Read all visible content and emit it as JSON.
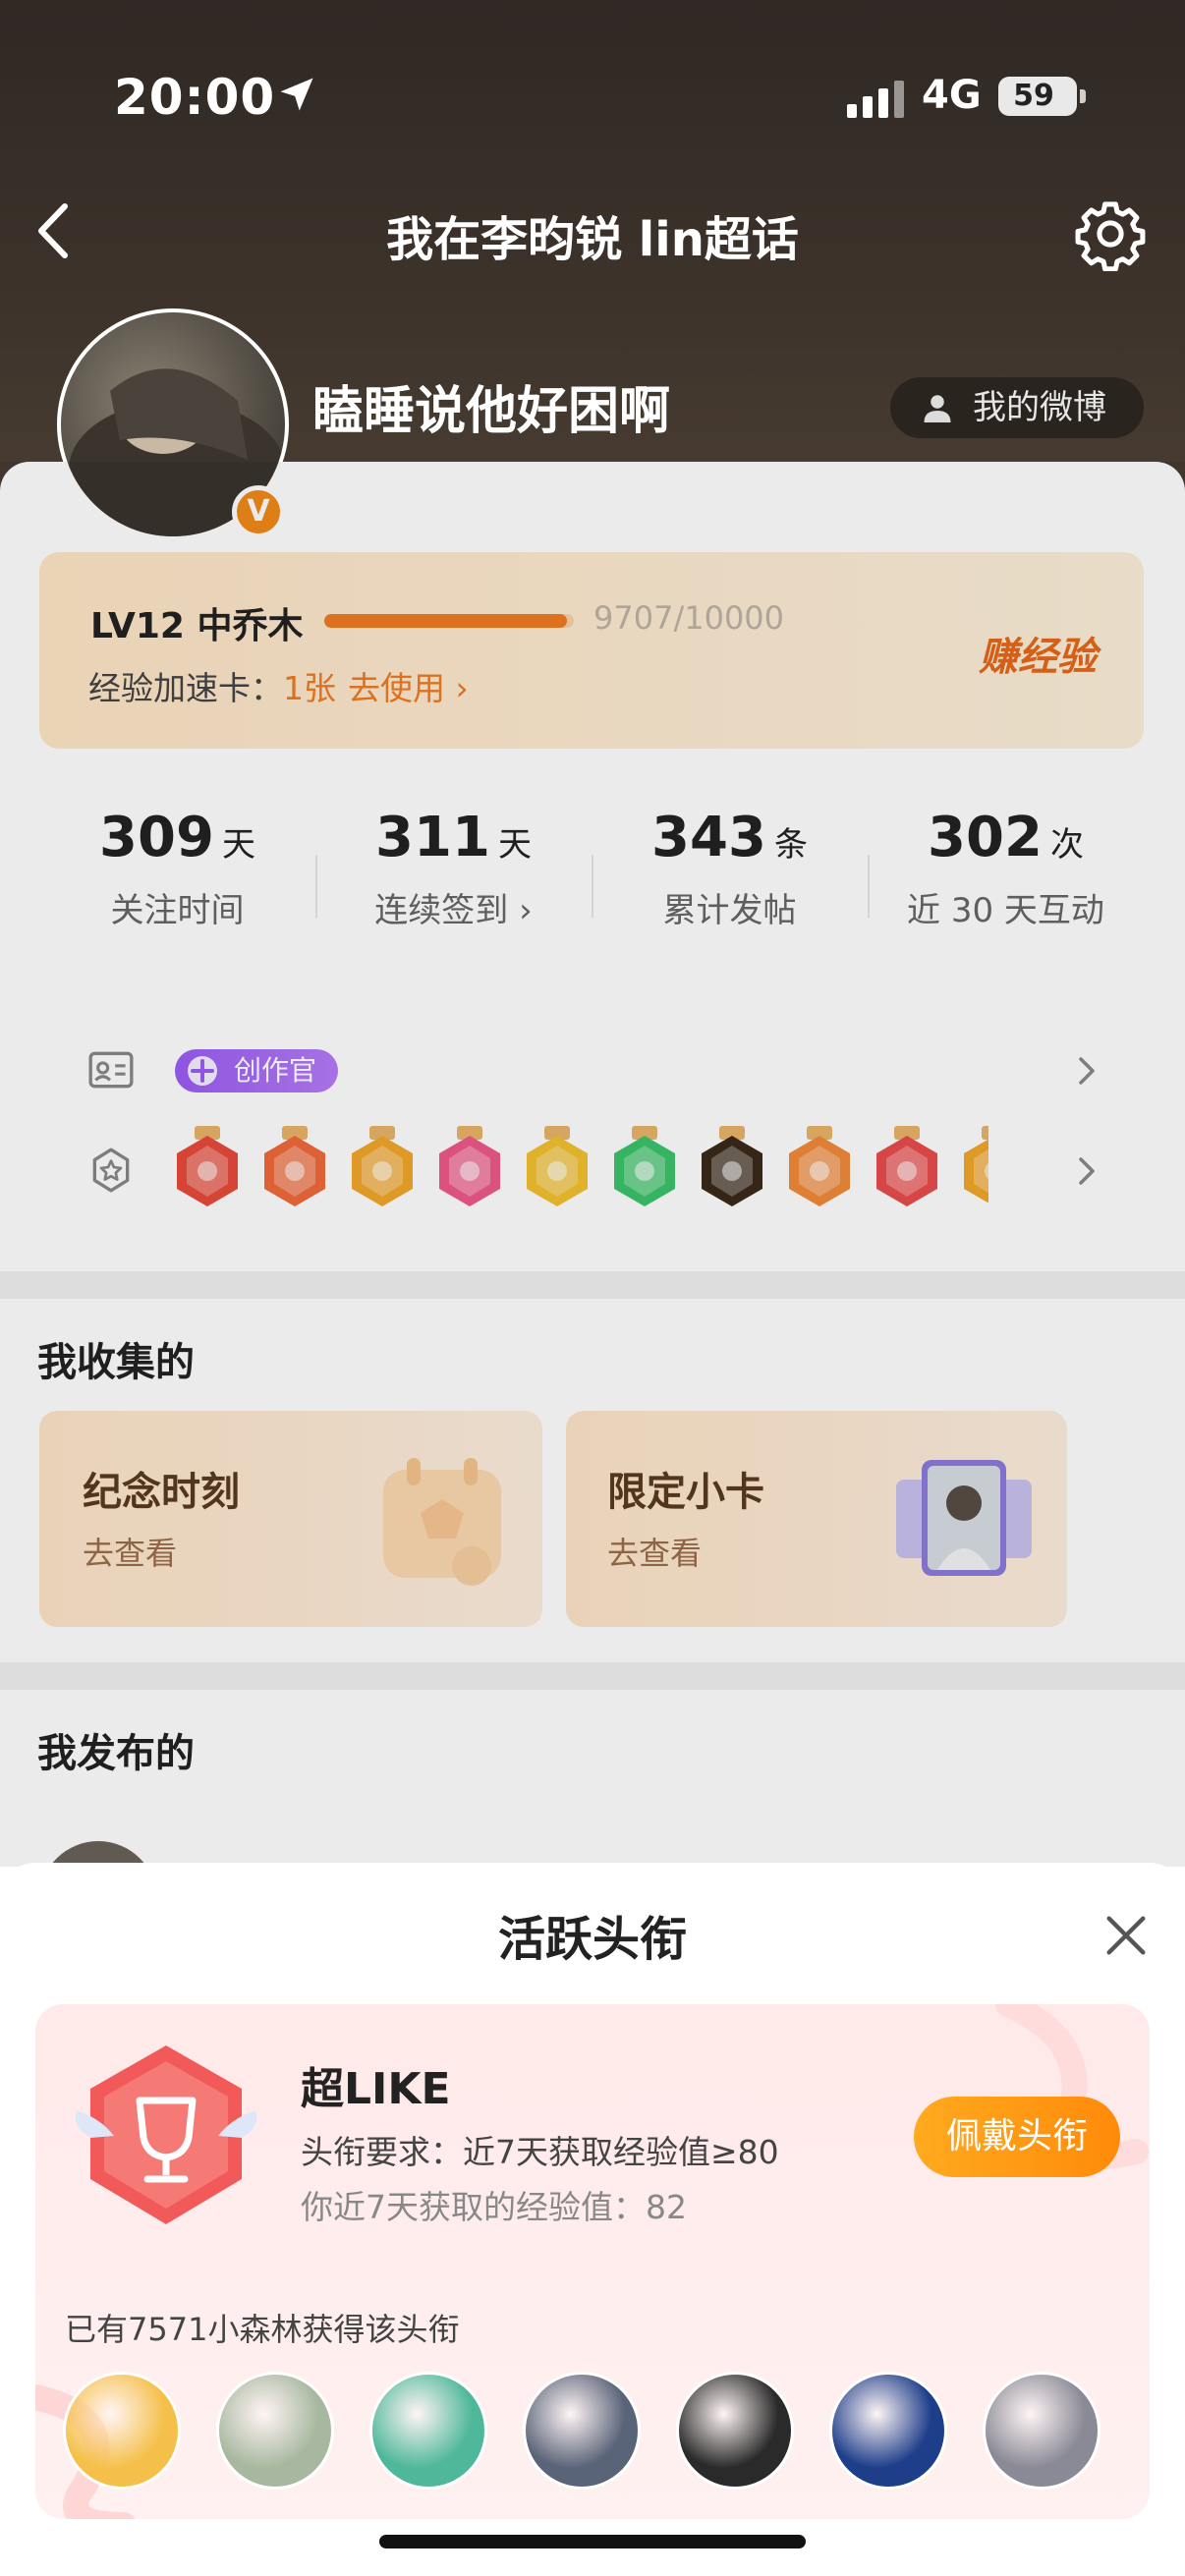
{
  "status_bar": {
    "time": "20:00",
    "network": "4G",
    "battery": "59"
  },
  "nav": {
    "title": "我在李昀锐 lin超话",
    "back_icon": "chevron-left-icon",
    "settings_icon": "gear-icon"
  },
  "profile": {
    "username": "瞌睡说他好困啊",
    "verified_badge": "V",
    "my_weibo_label": "我的微博"
  },
  "level": {
    "label": "LV12 中乔木",
    "progress_text": "9707/10000",
    "progress_fraction": 0.9707,
    "exp_card_label": "经验加速卡：",
    "exp_card_count": "1张",
    "exp_card_action": "去使用 ›",
    "earn_label": "赚经验"
  },
  "stats": [
    {
      "value": "309",
      "unit": "天",
      "label": "关注时间"
    },
    {
      "value": "311",
      "unit": "天",
      "label": "连续签到 ›"
    },
    {
      "value": "343",
      "unit": "条",
      "label": "累计发帖"
    },
    {
      "value": "302",
      "unit": "次",
      "label": "近 30 天互动"
    }
  ],
  "badges": {
    "creator_label": "创作官"
  },
  "medals": [
    {
      "icon": "cartoon-medal",
      "color": "#e84a3a"
    },
    {
      "icon": "rock-hand-medal",
      "color": "#f06a3a"
    },
    {
      "icon": "crown-medal",
      "color": "#f2a62a"
    },
    {
      "icon": "lv12-medal",
      "color": "#ef5a8a"
    },
    {
      "icon": "hi-medal",
      "color": "#f3c02e"
    },
    {
      "icon": "clover-medal",
      "color": "#3cc46a"
    },
    {
      "icon": "super-medal",
      "color": "#3a2a1a"
    },
    {
      "icon": "100-days-medal",
      "color": "#f28a3a"
    },
    {
      "icon": "trophy-medal",
      "color": "#ea4c4c"
    },
    {
      "icon": "partial-medal",
      "color": "#f2a62a"
    }
  ],
  "collected": {
    "title": "我收集的",
    "cards": [
      {
        "title": "纪念时刻",
        "sub": "去查看"
      },
      {
        "title": "限定小卡",
        "sub": "去查看"
      }
    ]
  },
  "published": {
    "title": "我发布的"
  },
  "sheet": {
    "title": "活跃头衔",
    "badge_name": "超LIKE",
    "requirement": "头衔要求：近7天获取经验值≥80",
    "mine": "你近7天获取的经验值：82",
    "wear_button": "佩戴头衔",
    "holders_label": "已有7571小森林获得该头衔",
    "holders": [
      {
        "icon": "sandwich-avatar",
        "color": "#f5c04a"
      },
      {
        "icon": "person-avatar",
        "color": "#a8b8a0"
      },
      {
        "icon": "panda-avatar",
        "color": "#4fb89a"
      },
      {
        "icon": "photo-avatar",
        "color": "#5a6478"
      },
      {
        "icon": "eye-avatar",
        "color": "#2a2a2a"
      },
      {
        "icon": "sea-avatar",
        "color": "#1e3e8a"
      },
      {
        "icon": "portrait-avatar",
        "color": "#8a8a96"
      }
    ]
  }
}
